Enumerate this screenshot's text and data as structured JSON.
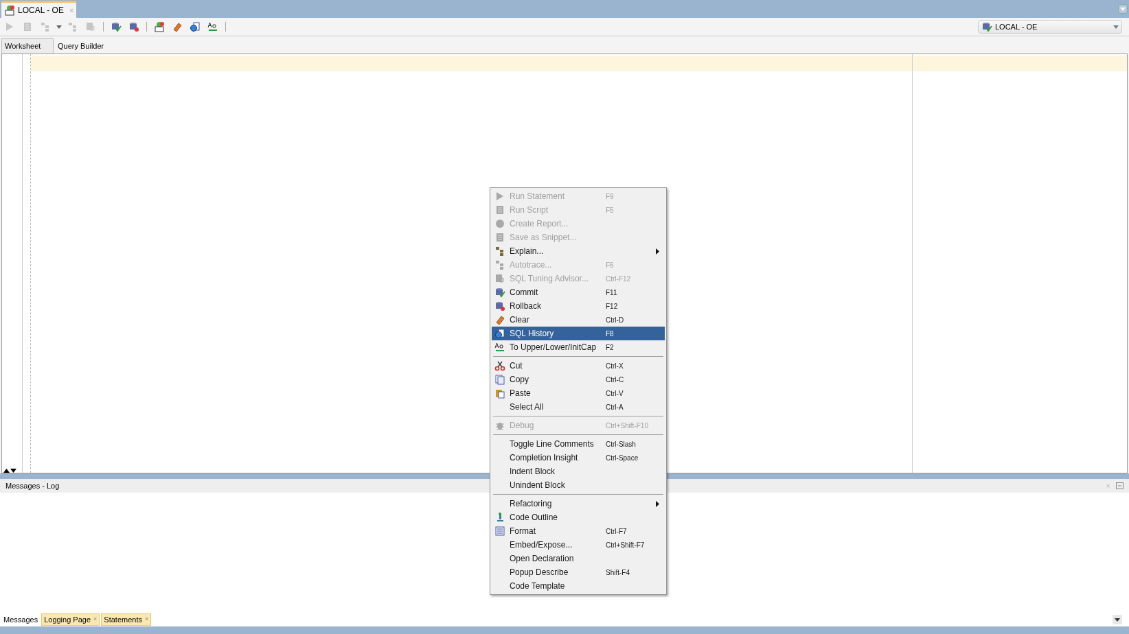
{
  "document_tab": {
    "title": "LOCAL - OE",
    "close": "×",
    "selected": true
  },
  "toolbar": {
    "buttons": [
      {
        "disabled": true
      },
      {
        "disabled": true
      },
      {
        "disabled": true,
        "dropdown": true
      },
      {
        "disabled": true
      },
      {
        "disabled": true
      },
      {
        "disabled": false
      },
      {
        "disabled": false
      },
      {
        "disabled": false
      },
      {
        "disabled": false
      },
      {
        "disabled": false
      },
      {
        "disabled": false
      }
    ]
  },
  "connection": {
    "value": "LOCAL - OE"
  },
  "editor_tabs": [
    {
      "label": "Worksheet",
      "selected": true
    },
    {
      "label": "Query Builder",
      "selected": false
    }
  ],
  "context_menu": {
    "items": [
      {
        "kind": "item",
        "label": "Run Statement",
        "shortcut": "F9",
        "disabled": true,
        "selected": false,
        "submenu": false
      },
      {
        "kind": "item",
        "label": "Run Script",
        "shortcut": "F5",
        "disabled": true,
        "selected": false,
        "submenu": false
      },
      {
        "kind": "item",
        "label": "Create Report...",
        "disabled": true,
        "selected": false,
        "submenu": false
      },
      {
        "kind": "item",
        "label": "Save as Snippet...",
        "disabled": true,
        "selected": false,
        "submenu": false
      },
      {
        "kind": "item",
        "label": "Explain...",
        "disabled": false,
        "selected": false,
        "submenu": true
      },
      {
        "kind": "item",
        "label": "Autotrace...",
        "shortcut": "F6",
        "disabled": true,
        "selected": false,
        "submenu": false
      },
      {
        "kind": "item",
        "label": "SQL Tuning Advisor...",
        "shortcut": "Ctrl-F12",
        "disabled": true,
        "selected": false,
        "submenu": false
      },
      {
        "kind": "item",
        "label": "Commit",
        "shortcut": "F11",
        "disabled": false,
        "selected": false,
        "submenu": false
      },
      {
        "kind": "item",
        "label": "Rollback",
        "shortcut": "F12",
        "disabled": false,
        "selected": false,
        "submenu": false
      },
      {
        "kind": "item",
        "label": "Clear",
        "shortcut": "Ctrl-D",
        "disabled": false,
        "selected": false,
        "submenu": false
      },
      {
        "kind": "item",
        "label": "SQL History",
        "shortcut": "F8",
        "disabled": false,
        "selected": true,
        "submenu": false
      },
      {
        "kind": "item",
        "label": "To Upper/Lower/InitCap",
        "shortcut": "F2",
        "disabled": false,
        "selected": false,
        "submenu": false
      },
      {
        "kind": "separator"
      },
      {
        "kind": "item",
        "label": "Cut",
        "shortcut": "Ctrl-X",
        "disabled": false,
        "selected": false,
        "submenu": false
      },
      {
        "kind": "item",
        "label": "Copy",
        "shortcut": "Ctrl-C",
        "disabled": false,
        "selected": false,
        "submenu": false
      },
      {
        "kind": "item",
        "label": "Paste",
        "shortcut": "Ctrl-V",
        "disabled": false,
        "selected": false,
        "submenu": false
      },
      {
        "kind": "item",
        "label": "Select All",
        "shortcut": "Ctrl-A",
        "disabled": false,
        "selected": false,
        "submenu": false
      },
      {
        "kind": "separator"
      },
      {
        "kind": "item",
        "label": "Debug",
        "shortcut": "Ctrl+Shift-F10",
        "disabled": true,
        "selected": false,
        "submenu": false
      },
      {
        "kind": "separator"
      },
      {
        "kind": "item",
        "label": "Toggle Line Comments",
        "shortcut": "Ctrl-Slash",
        "disabled": false,
        "selected": false,
        "submenu": false
      },
      {
        "kind": "item",
        "label": "Completion Insight",
        "shortcut": "Ctrl-Space",
        "disabled": false,
        "selected": false,
        "submenu": false
      },
      {
        "kind": "item",
        "label": "Indent Block",
        "disabled": false,
        "selected": false,
        "submenu": false
      },
      {
        "kind": "item",
        "label": "Unindent Block",
        "disabled": false,
        "selected": false,
        "submenu": false
      },
      {
        "kind": "separator"
      },
      {
        "kind": "item",
        "label": "Refactoring",
        "disabled": false,
        "selected": false,
        "submenu": true
      },
      {
        "kind": "item",
        "label": "Code Outline",
        "disabled": false,
        "selected": false,
        "submenu": false
      },
      {
        "kind": "item",
        "label": "Format",
        "shortcut": "Ctrl-F7",
        "disabled": false,
        "selected": false,
        "submenu": false
      },
      {
        "kind": "item",
        "label": "Embed/Expose...",
        "shortcut": "Ctrl+Shift-F7",
        "disabled": false,
        "selected": false,
        "submenu": false
      },
      {
        "kind": "item",
        "label": "Open Declaration",
        "disabled": false,
        "selected": false,
        "submenu": false
      },
      {
        "kind": "item",
        "label": "Popup Describe",
        "shortcut": "Shift-F4",
        "disabled": false,
        "selected": false,
        "submenu": false
      },
      {
        "kind": "item",
        "label": "Code Template",
        "disabled": false,
        "selected": false,
        "submenu": false
      }
    ]
  },
  "log_panel": {
    "title": "Messages - Log",
    "close": "×"
  },
  "bottom_tabs": [
    {
      "label": "Messages",
      "selected": true,
      "closable": false
    },
    {
      "label": "Logging Page",
      "selected": false,
      "closable": true,
      "close": "×"
    },
    {
      "label": "Statements",
      "selected": false,
      "closable": true,
      "close": "×"
    }
  ]
}
